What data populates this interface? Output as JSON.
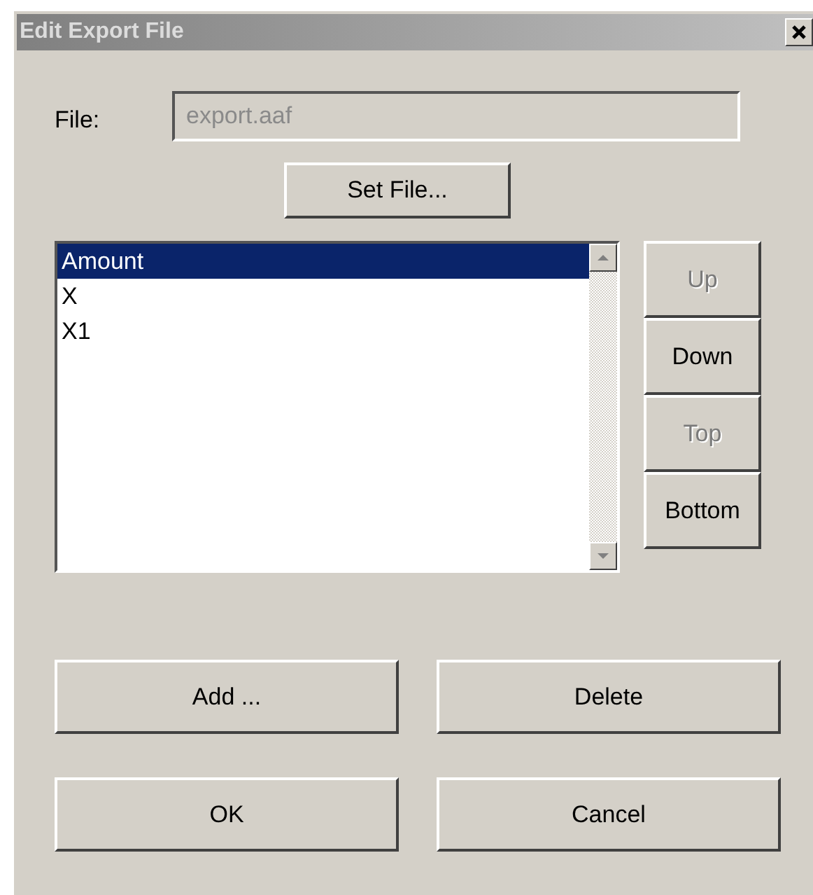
{
  "window": {
    "title": "Edit Export File"
  },
  "file": {
    "label": "File:",
    "value": "export.aaf",
    "disabled": true
  },
  "set_file_button": {
    "label": "Set File..."
  },
  "list": {
    "items": [
      {
        "label": "Amount",
        "selected": true
      },
      {
        "label": "X",
        "selected": false
      },
      {
        "label": "X1",
        "selected": false
      }
    ]
  },
  "side_buttons": [
    {
      "label": "Up",
      "disabled": true
    },
    {
      "label": "Down",
      "disabled": false
    },
    {
      "label": "Top",
      "disabled": true
    },
    {
      "label": "Bottom",
      "disabled": false
    }
  ],
  "action_buttons": [
    {
      "label": "Add ...",
      "disabled": false
    },
    {
      "label": "Delete",
      "disabled": false
    }
  ],
  "dialog_buttons": [
    {
      "label": "OK",
      "disabled": false
    },
    {
      "label": "Cancel",
      "disabled": false
    }
  ]
}
